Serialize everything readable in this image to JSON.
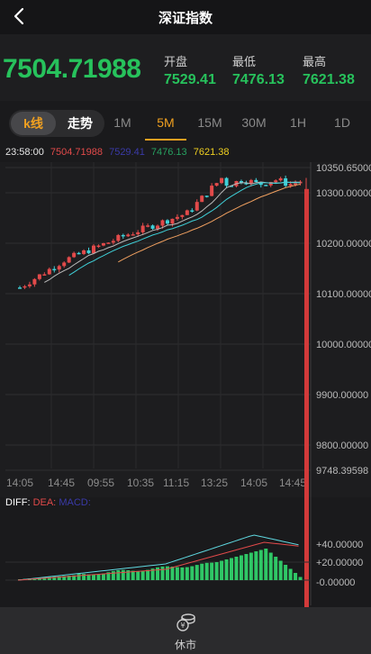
{
  "header": {
    "title": "深证指数"
  },
  "quote": {
    "price": "7504.71988",
    "open_label": "开盘",
    "open": "7529.41",
    "low_label": "最低",
    "low": "7476.13",
    "high_label": "最高",
    "high": "7621.38"
  },
  "tabs": {
    "kline": "k线",
    "trend": "走势",
    "periods": [
      "1M",
      "5M",
      "15M",
      "30M",
      "1H",
      "1D"
    ],
    "active_period": "5M"
  },
  "info": {
    "time": "23:58:00",
    "price": "7504.71988",
    "ma1": "7529.41",
    "ma2": "7476.13",
    "ma3": "7621.38"
  },
  "macd": {
    "diff_label": "DIFF:",
    "dea_label": "DEA:",
    "macd_label": "MACD:"
  },
  "footer": {
    "label": "休市"
  },
  "colors": {
    "up": "#e24a4a",
    "down": "#3fd0d8",
    "accent": "#f0a020",
    "green": "#27c25c"
  },
  "chart_data": {
    "type": "candlestick",
    "y_ticks": [
      "10350.65000",
      "10300.00000",
      "10200.00000",
      "10100.00000",
      "10000.00000",
      "9900.00000",
      "9800.00000",
      "9748.39598"
    ],
    "x_ticks": [
      "14:05",
      "14:45",
      "09:55",
      "10:35",
      "11:15",
      "13:25",
      "14:05",
      "14:45"
    ],
    "macd_ticks": [
      "+40.00000",
      "+20.00000",
      "-0.00000"
    ],
    "ylim": [
      9748.39598,
      10350.65
    ]
  }
}
